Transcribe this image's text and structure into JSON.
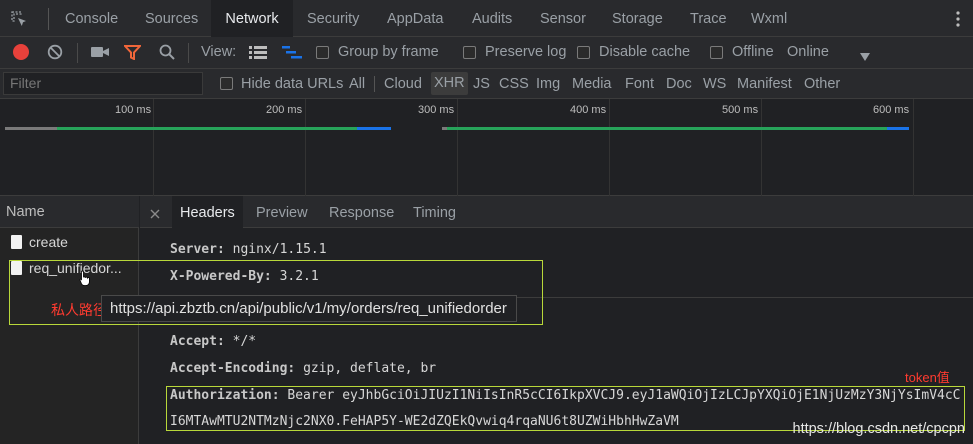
{
  "top_tabs": [
    "Console",
    "Sources",
    "Network",
    "Security",
    "AppData",
    "Audits",
    "Sensor",
    "Storage",
    "Trace",
    "Wxml"
  ],
  "active_tab": "Network",
  "toolbar": {
    "view_label": "View:",
    "group_by_frame": "Group by frame",
    "preserve_log": "Preserve log",
    "disable_cache": "Disable cache",
    "offline": "Offline",
    "online": "Online"
  },
  "filter": {
    "placeholder": "Filter",
    "hide_data_urls": "Hide data URLs",
    "types": [
      "All",
      "Cloud",
      "XHR",
      "JS",
      "CSS",
      "Img",
      "Media",
      "Font",
      "Doc",
      "WS",
      "Manifest",
      "Other"
    ],
    "selected": "XHR"
  },
  "timeline": {
    "ticks": [
      "100 ms",
      "200 ms",
      "300 ms",
      "400 ms",
      "500 ms",
      "600 ms"
    ]
  },
  "requests": {
    "header": "Name",
    "items": [
      "create",
      "req_unifiedor..."
    ]
  },
  "detail_tabs": [
    "Headers",
    "Preview",
    "Response",
    "Timing"
  ],
  "headers": {
    "server_key": "Server:",
    "server_val": "nginx/1.15.1",
    "powered_key": "X-Powered-By:",
    "powered_val": "3.2.1",
    "accept_key": "Accept:",
    "accept_val": "*/*",
    "encoding_key": "Accept-Encoding:",
    "encoding_val": "gzip, deflate, br",
    "auth_key": "Authorization:",
    "auth_val": "Bearer eyJhbGciOiJIUzI1NiIsInR5cCI6IkpXVCJ9.eyJ1aWQiOjIzLCJpYXQiOjE1NjUzMzY3NjYsImV4cC",
    "auth_cont": "I6MTAwMTU2NTMzNjc2NX0.FeHAP5Y-WE2dZQEkQvwiq4rqaNU6t8UZWiHbhHwZaVM"
  },
  "annotations": {
    "private_path": "私人路径",
    "tooltip_url": "https://api.zbztb.cn/api/public/v1/my/orders/req_unifiedorder",
    "token_label": "token值",
    "watermark": "https://blog.csdn.net/cpcpn"
  },
  "colors": {
    "record_red": "#e8413b",
    "filter_orange": "#f0663a",
    "highlight_green": "#b9d83a",
    "bar_green": "#27a35a",
    "bar_blue": "#1a73e8"
  }
}
